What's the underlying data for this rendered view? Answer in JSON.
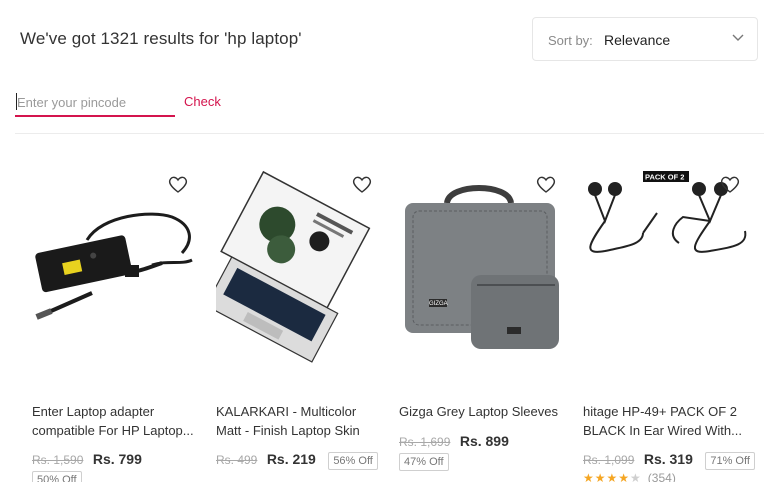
{
  "header": {
    "results_text": "We've got 1321 results for 'hp laptop'",
    "sort_label": "Sort by:",
    "sort_value": "Relevance"
  },
  "pincode": {
    "placeholder": "Enter your pincode",
    "check_label": "Check"
  },
  "colors": {
    "accent": "#d4144d",
    "rating": "#f5a623"
  },
  "products": [
    {
      "name_line1": "Enter Laptop adapter",
      "name_line2": "compatible For HP Laptop...",
      "mrp": "Rs. 1,590",
      "price": "Rs. 799",
      "discount": "50% Off"
    },
    {
      "name_line1": "KALARKARI - Multicolor",
      "name_line2": "Matt - Finish Laptop Skin",
      "mrp": "Rs. 499",
      "price": "Rs. 219",
      "discount": "56% Off"
    },
    {
      "name_line1": "Gizga Grey Laptop Sleeves",
      "mrp": "Rs. 1,699",
      "price": "Rs. 899",
      "discount": "47% Off",
      "brand_text": "GIZGA"
    },
    {
      "name_line1": "hitage HP-49+ PACK OF 2",
      "name_line2": "BLACK In Ear Wired With...",
      "mrp": "Rs. 1,099",
      "price": "Rs. 319",
      "discount": "71% Off",
      "rating_stars": 4,
      "rating_count": "(354)",
      "badge": "PACK OF 2"
    }
  ]
}
